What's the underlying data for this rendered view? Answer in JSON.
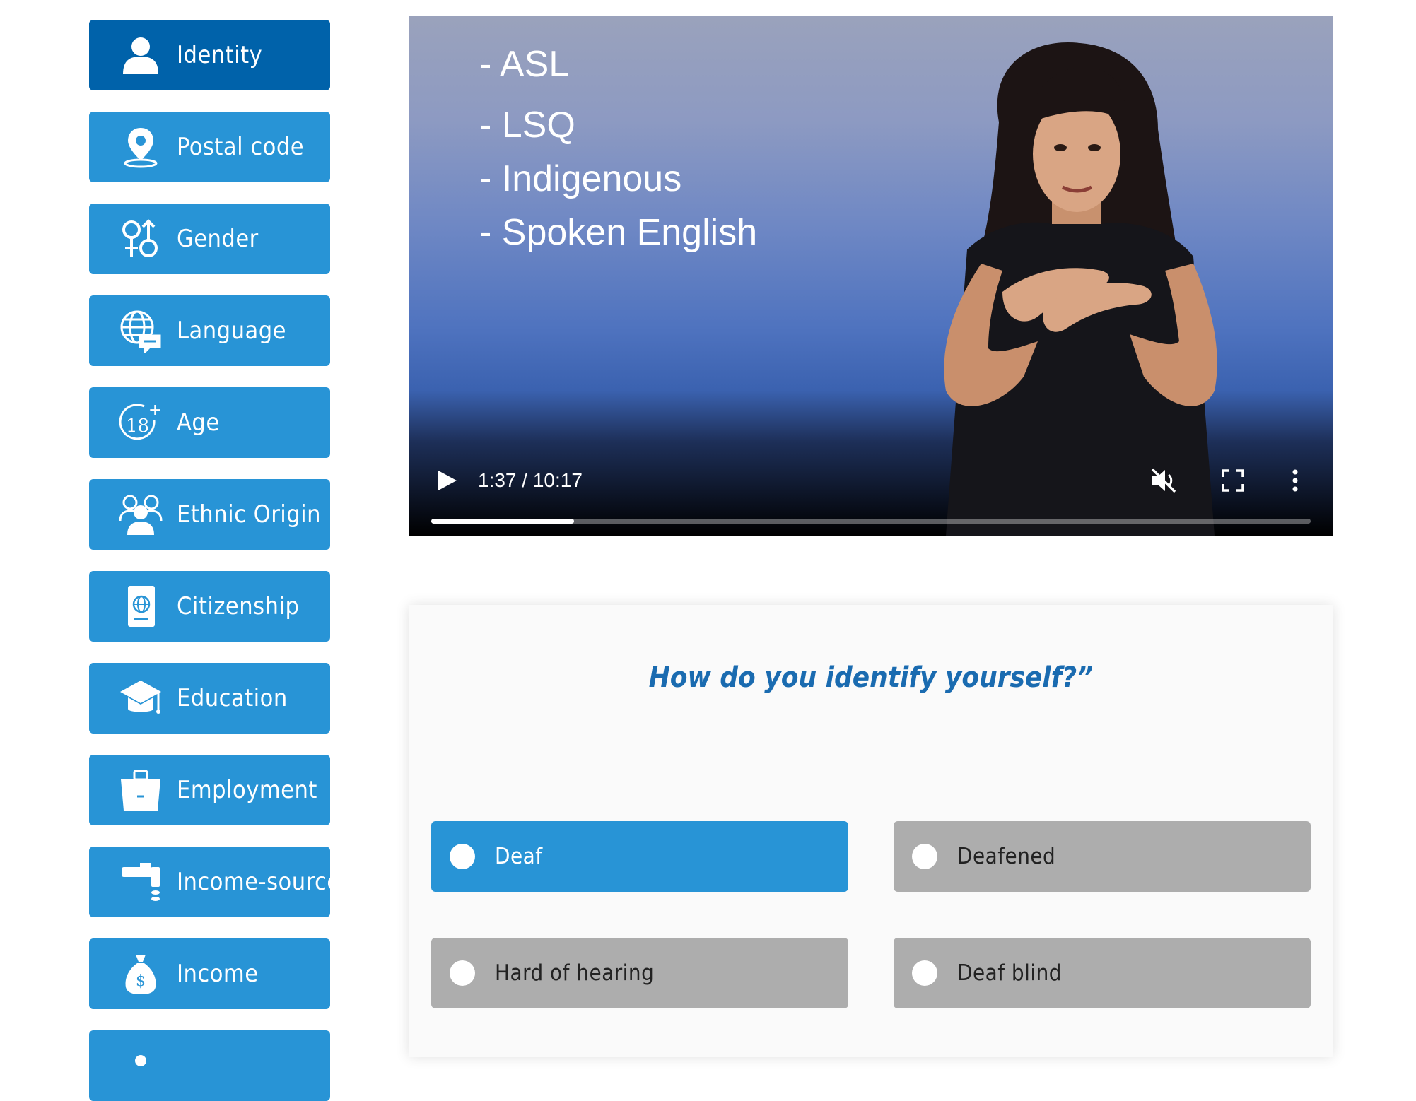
{
  "sidebar": {
    "items": [
      {
        "label": "Identity",
        "icon": "person-icon",
        "active": true
      },
      {
        "label": "Postal code",
        "icon": "location-pin-icon",
        "active": false
      },
      {
        "label": "Gender",
        "icon": "gender-symbols-icon",
        "active": false
      },
      {
        "label": "Language",
        "icon": "globe-speech-icon",
        "active": false
      },
      {
        "label": "Age",
        "icon": "age-18-plus-icon",
        "active": false
      },
      {
        "label": "Ethnic Origin",
        "icon": "people-group-icon",
        "active": false
      },
      {
        "label": "Citizenship",
        "icon": "passport-icon",
        "active": false
      },
      {
        "label": "Education",
        "icon": "graduation-cap-icon",
        "active": false
      },
      {
        "label": "Employment",
        "icon": "briefcase-icon",
        "active": false
      },
      {
        "label": "Income-source",
        "icon": "faucet-icon",
        "active": false
      },
      {
        "label": "Income",
        "icon": "money-bag-icon",
        "active": false
      },
      {
        "label": "",
        "icon": "partial-icon",
        "active": false
      }
    ]
  },
  "video": {
    "lines": [
      "- ASL",
      "- LSQ",
      "- Indigenous",
      "- Spoken English"
    ],
    "time": "1:37 / 10:17",
    "progress": 0.1627,
    "muted": true
  },
  "question": {
    "text": "How do you identify yourself?”",
    "options": [
      {
        "label": "Deaf",
        "selected": true
      },
      {
        "label": "Deafened",
        "selected": false
      },
      {
        "label": "Hard of hearing",
        "selected": false
      },
      {
        "label": "Deaf blind",
        "selected": false
      }
    ]
  },
  "colors": {
    "nav_bg": "#2894d6",
    "nav_active_bg": "#0062aa",
    "option_selected_bg": "#2894d6",
    "option_bg": "#adadad",
    "question_text": "#1a6bb0"
  }
}
